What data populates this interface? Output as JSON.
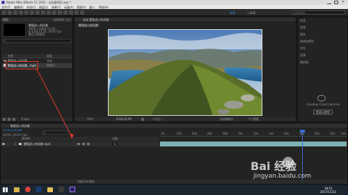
{
  "window": {
    "title": "Adobe After Effects CC 2015 - 无标题项目.aep *"
  },
  "menu": [
    "文件(F)",
    "编辑(E)",
    "合成(C)",
    "图层(L)",
    "效果(T)",
    "动画(A)",
    "视图(V)",
    "窗口",
    "帮助(H)"
  ],
  "toolbar": {
    "workspace": "标准",
    "workspace2": "小屏幕",
    "search_placeholder": "搜索帮助"
  },
  "project_panel": {
    "tab": "项目",
    "tab2": "效果控件 (无)",
    "thumb_name": "蒙版进入的风景",
    "thumb_info": "1920 x 1080 (1.00)",
    "thumb_info2": "Δ 0;00;12;26, 29.97 fps",
    "thumb_info3": "数百万种颜色",
    "search_placeholder": "ρ",
    "columns": [
      "名称",
      "类型"
    ],
    "items": [
      {
        "name": "蒙版进入的风景",
        "type": "合成"
      },
      {
        "name": "蒙版进入的风景...mp4",
        "type": "MPEG"
      }
    ],
    "bpc": "8 bpc"
  },
  "composition": {
    "tab": "合成 蒙版进入的风景",
    "breadcrumb": "蒙版进入的风景",
    "zoom": "50%",
    "timecode": "0;00;23;09",
    "resolution": "二分之一",
    "camera": "活动摄像机",
    "views": "1个视图"
  },
  "right_panel": {
    "items": [
      "信息",
      "音频",
      "预览",
      "效果和预设",
      "字符",
      "段落",
      "跟踪器"
    ],
    "library_text": "Creative Cloud Libraries",
    "library_button": "登录以使用"
  },
  "timeline": {
    "tab": "蒙版进入的风景",
    "timecode": "0;00;23;09",
    "timecode_sub": "00701 (29.97 fps)",
    "search_placeholder": "ρ",
    "columns": [
      "源名称",
      "父级"
    ],
    "layer_name": "蒙版进入的风景.mp4",
    "layer_number": "1",
    "parent": "无",
    "ruler_ticks": [
      "0s",
      "02s",
      "04s",
      "06s",
      "08s",
      "10s",
      "12s",
      "14s",
      "16s",
      "18s",
      "20s",
      "22s",
      "24s"
    ],
    "footer": "切换开关/模式"
  },
  "taskbar": {
    "time": "18:51",
    "date": "2017/11/23"
  },
  "watermark": {
    "brand": "Bai 经验",
    "url": "jingyan.baidu.com"
  },
  "colors": {
    "accent": "#2d8ceb",
    "layer": "#7fb1b3",
    "annotation": "#e0392b",
    "playhead": "#3a6fd8"
  }
}
